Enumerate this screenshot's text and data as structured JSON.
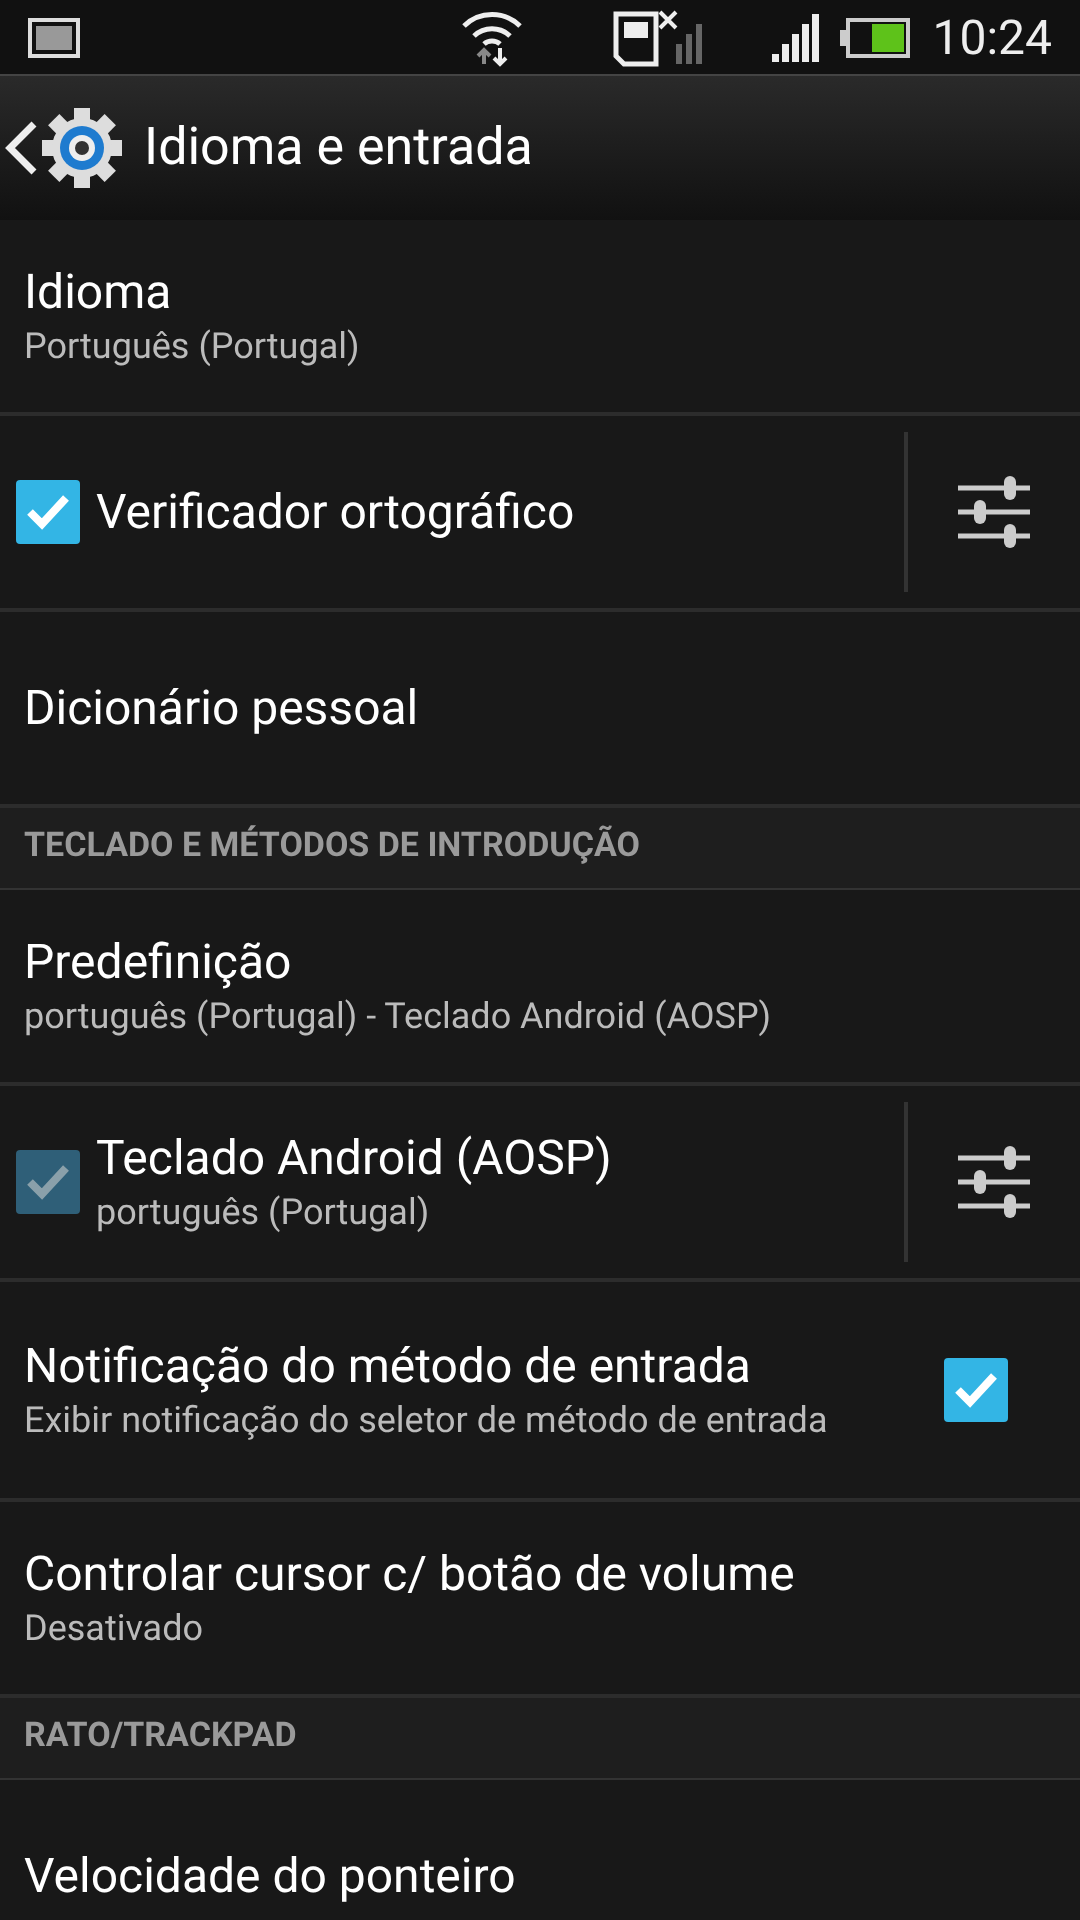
{
  "status_bar": {
    "time": "10:24"
  },
  "action_bar": {
    "title": "Idioma e entrada"
  },
  "rows": [
    {
      "kind": "plain",
      "title": "Idioma",
      "summary": "Português (Portugal)"
    },
    {
      "kind": "check_settings",
      "title": "Verificador ortográfico",
      "checked": true,
      "disabled": false
    },
    {
      "kind": "plain",
      "title": "Dicionário pessoal"
    },
    {
      "kind": "section",
      "title": "TECLADO E MÉTODOS DE INTRODUÇÃO"
    },
    {
      "kind": "plain",
      "title": "Predefinição",
      "summary": "português (Portugal) - Teclado Android (AOSP)"
    },
    {
      "kind": "check_settings",
      "title": "Teclado Android (AOSP)",
      "summary": "português (Portugal)",
      "checked": true,
      "disabled": true
    },
    {
      "kind": "check_right",
      "title": "Notificação do método de entrada",
      "summary": "Exibir notificação do seletor de método de entrada",
      "checked": true,
      "disabled": false
    },
    {
      "kind": "plain",
      "title": "Controlar cursor c/ botão de volume",
      "summary": "Desativado"
    },
    {
      "kind": "section",
      "title": "RATO/TRACKPAD"
    },
    {
      "kind": "plain",
      "title": "Velocidade do ponteiro"
    }
  ]
}
